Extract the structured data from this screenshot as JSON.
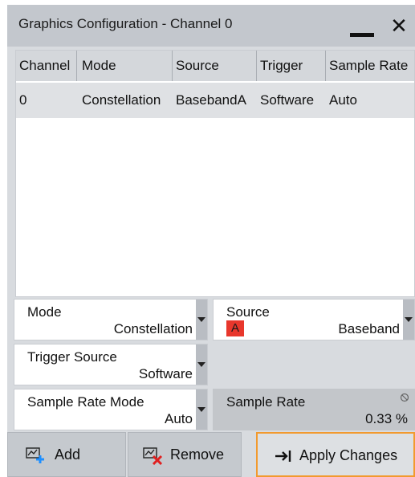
{
  "window": {
    "title": "Graphics Configuration - Channel 0",
    "minimize_icon": "minimize-icon",
    "close_icon": "close-icon",
    "close_glyph": "✕"
  },
  "table": {
    "columns": [
      "Channel",
      "Mode",
      "Source",
      "Trigger",
      "Sample Rate"
    ],
    "rows": [
      {
        "channel": "0",
        "mode": "Constellation",
        "source": "BasebandA",
        "trigger": "Software",
        "sample_rate": "Auto"
      }
    ]
  },
  "fields": {
    "mode": {
      "label": "Mode",
      "value": "Constellation"
    },
    "source": {
      "label": "Source",
      "badge": "A",
      "value": "Baseband"
    },
    "trigger_source": {
      "label": "Trigger Source",
      "value": "Software"
    },
    "sample_rate_mode": {
      "label": "Sample Rate Mode",
      "value": "Auto"
    },
    "sample_rate": {
      "label": "Sample Rate",
      "value": "0.33 %"
    }
  },
  "buttons": {
    "add": "Add",
    "remove": "Remove",
    "apply": "Apply Changes"
  },
  "colors": {
    "accent_orange": "#f29a2e",
    "source_badge_red": "#e8372c",
    "add_icon_blue": "#1f8fff",
    "remove_icon_red": "#e02020"
  }
}
